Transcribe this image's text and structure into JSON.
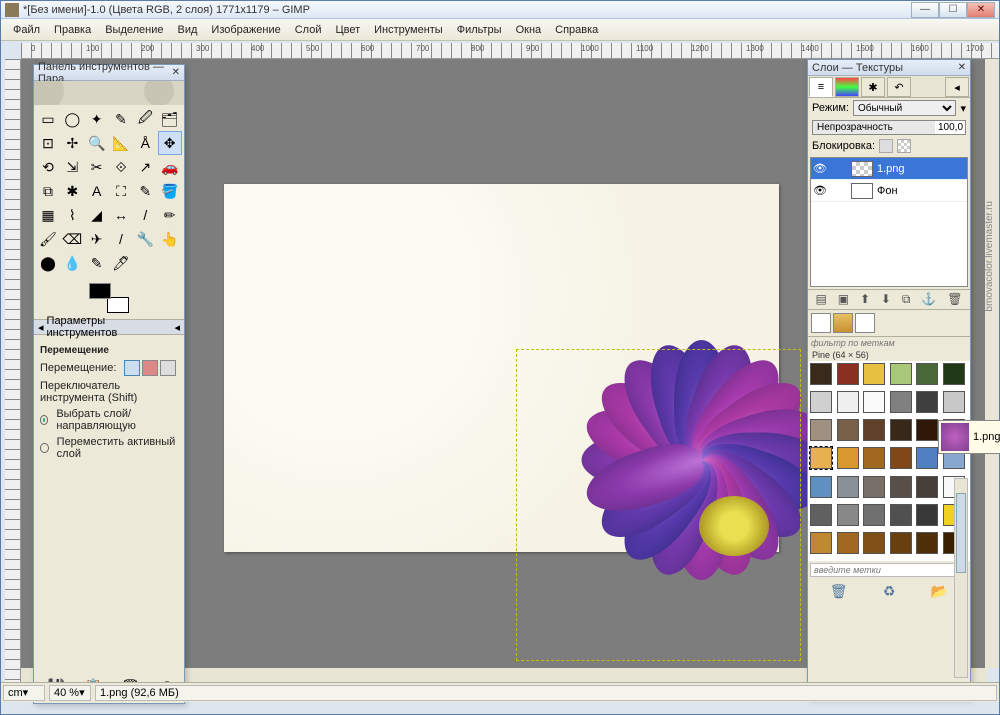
{
  "window": {
    "title": "*[Без имени]-1.0 (Цвета RGB, 2 слоя) 1771x1179 – GIMP",
    "min": "—",
    "max": "☐",
    "close": "✕"
  },
  "menu": [
    "Файл",
    "Правка",
    "Выделение",
    "Вид",
    "Изображение",
    "Слой",
    "Цвет",
    "Инструменты",
    "Фильтры",
    "Окна",
    "Справка"
  ],
  "toolbox": {
    "title": "Панель инструментов — Пара...",
    "close": "✕",
    "tools": [
      "▭",
      "◯",
      "✦",
      "✎",
      "🖉",
      "🗂",
      "⊡",
      "✢",
      "🔍",
      "📐",
      "Å",
      "✥",
      "⟲",
      "⇲",
      "✂",
      "⟐",
      "↗",
      "🚗",
      "⧉",
      "✱",
      "A",
      "⛶",
      "✎",
      "🪣",
      "▦",
      "⌇",
      "◢",
      "↔",
      "/",
      "✏",
      "🖌",
      "⌫",
      "✈",
      "/",
      "🔧",
      "👆",
      "⬤",
      "💧",
      "✎",
      "🖊"
    ],
    "options_title": "Параметры инструментов",
    "section": "Перемещение",
    "move_label": "Перемещение:",
    "switch_label": "Переключатель инструмента  (Shift)",
    "opt1": "Выбрать слой/направляющую",
    "opt2": "Переместить активный слой",
    "bottom": [
      "💾",
      "📋",
      "🗑",
      "↺"
    ]
  },
  "layers": {
    "title": "Слои — Текстуры",
    "close": "✕",
    "mode_label": "Режим:",
    "mode_value": "Обычный",
    "opacity_label": "Непрозрачность",
    "opacity_value": "100,0",
    "lock_label": "Блокировка:",
    "items": [
      {
        "name": "1.png",
        "selected": true,
        "checker": true
      },
      {
        "name": "Фон",
        "selected": false,
        "checker": false
      }
    ],
    "btns": [
      "▤",
      "▣",
      "⬆",
      "⬇",
      "⧉",
      "⚓",
      "🗑"
    ],
    "filter_placeholder": "фильтр по меткам",
    "tex_info": "Pine (64 × 56)",
    "enter_placeholder": "введите метки",
    "preview_name": "1.png",
    "bottom": [
      "🗑",
      "♻",
      "📂"
    ]
  },
  "textures": [
    "#3a2a1a",
    "#8a3020",
    "#e8c040",
    "#a8c878",
    "#486838",
    "#203818",
    "#d0d0d0",
    "#f0f0f0",
    "#fafafa",
    "#808080",
    "#404040",
    "#c8c8c8",
    "#a09080",
    "#786048",
    "#604028",
    "#382818",
    "#301808",
    "#483020",
    "#e8b050",
    "#d89830",
    "#a06820",
    "#804818",
    "#5080c0",
    "#88a8d0",
    "#6090c0",
    "#889098",
    "#787068",
    "#585048",
    "#484038",
    "#f8f8f8",
    "#606060",
    "#888888",
    "#707070",
    "#505050",
    "#383838",
    "#f0d020",
    "#c08830",
    "#a06820",
    "#805018",
    "#684010",
    "#503008",
    "#382000"
  ],
  "statusbar": {
    "unit": "cm",
    "zoom": "40 %",
    "status": "1.png (92,6 МБ)"
  },
  "ruler_labels": [
    "0",
    "100",
    "200",
    "300",
    "400",
    "500",
    "600",
    "700",
    "800",
    "900",
    "1000",
    "1100",
    "1200",
    "1300",
    "1400",
    "1500",
    "1600",
    "1700"
  ],
  "watermark": "bmovacolor.livemaster.ru"
}
